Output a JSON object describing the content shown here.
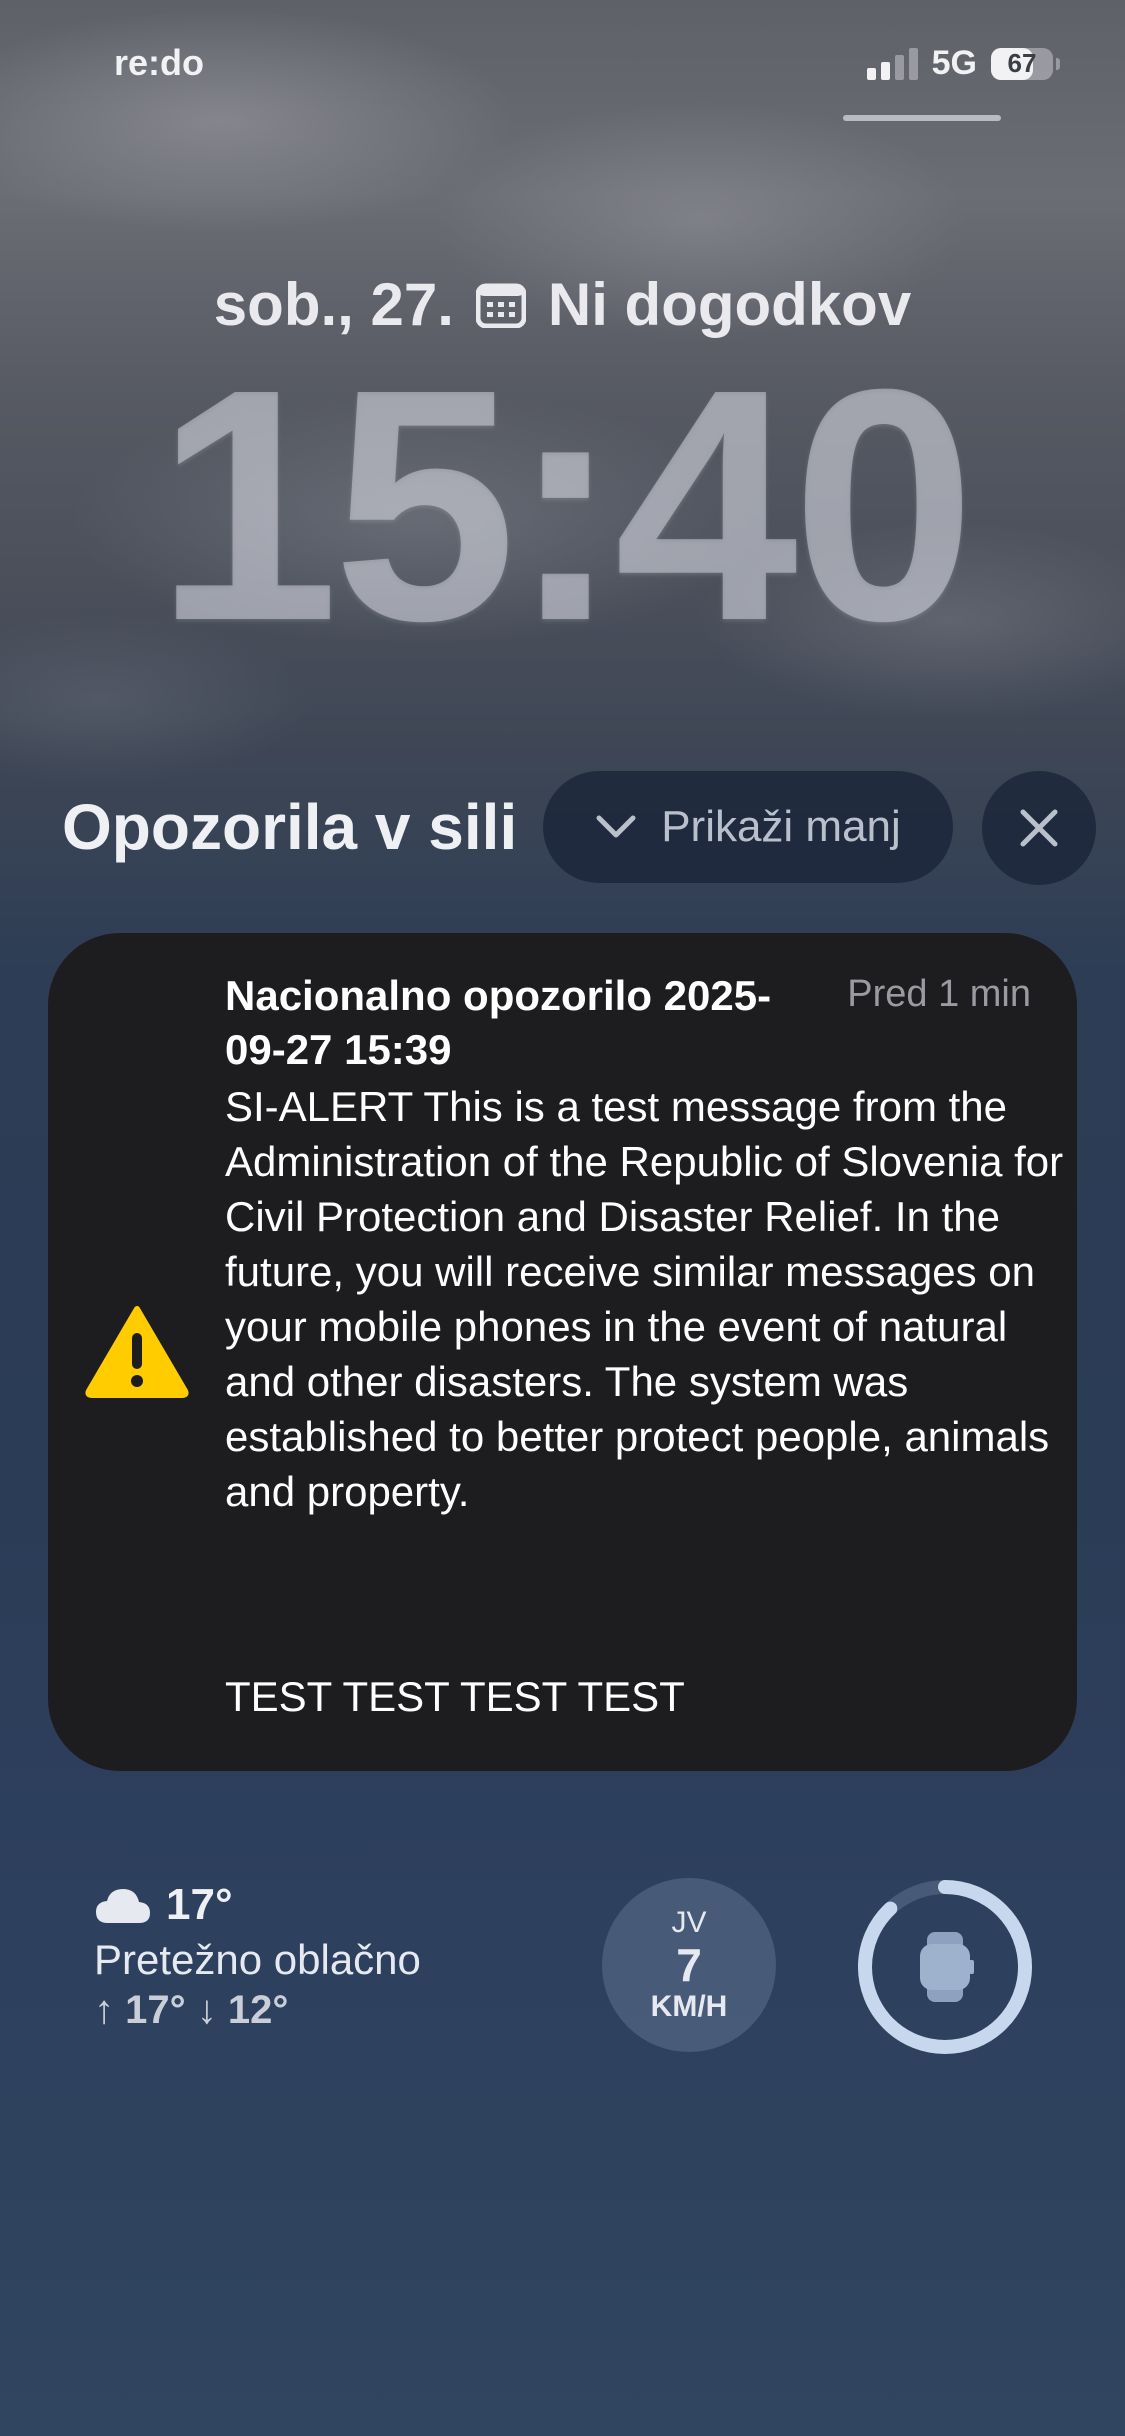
{
  "status_bar": {
    "carrier": "re:do",
    "network": "5G",
    "battery_percent": 67
  },
  "lock_screen": {
    "date": "sob., 27.",
    "calendar_icon": "calendar-icon",
    "events": "Ni dogodkov",
    "time": "15:40"
  },
  "alerts_header": {
    "title": "Opozorila v sili",
    "show_less_label": "Prikaži manj",
    "chevron_icon": "chevron-down-icon",
    "close_icon": "close-icon"
  },
  "alert": {
    "icon": "warning-icon",
    "title": "Nacionalno opozorilo 2025-09-27 15:39",
    "time": "Pred 1 min",
    "body": "SI-ALERT This is a test message from the Administration of the Republic of Slovenia for Civil Protection and Disaster Relief. In the future, you will receive similar messages on your mobile phones in the event of natural and other disasters. The system was established to better protect people, animals and property.",
    "footer": "TEST TEST TEST TEST"
  },
  "weather": {
    "icon": "cloud-icon",
    "temperature": "17°",
    "condition": "Pretežno oblačno",
    "range": "↑ 17° ↓ 12°"
  },
  "wind": {
    "direction": "JV",
    "speed": "7",
    "unit": "KM/H"
  },
  "watch_widget": {
    "icon": "watch-icon",
    "ring_fraction": 0.88
  },
  "colors": {
    "warning_yellow": "#ffcc00",
    "card_background": "#1d1d1f"
  }
}
